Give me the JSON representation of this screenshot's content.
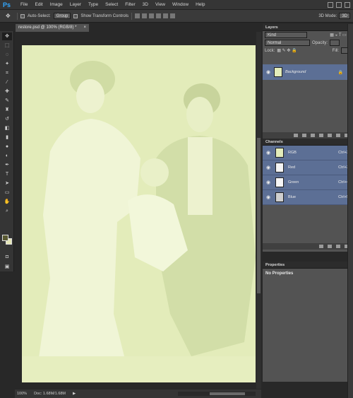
{
  "app": {
    "logo": "Ps"
  },
  "menu": [
    "File",
    "Edit",
    "Image",
    "Layer",
    "Type",
    "Select",
    "Filter",
    "3D",
    "View",
    "Window",
    "Help"
  ],
  "options_bar": {
    "auto_select_label": "Auto-Select:",
    "auto_select_value": "Group",
    "show_transform": "Show Transform Controls",
    "mode3d_label": "3D Mode:",
    "mode3d_value": "3D"
  },
  "doc_tab": {
    "title": "restore.psd @ 100% (RGB/8) *",
    "close": "×"
  },
  "status": {
    "zoom": "100%",
    "doc": "Doc: 1.68M/1.68M"
  },
  "layers_panel": {
    "title": "Layers",
    "filter": "Kind",
    "blend": "Normal",
    "opacity_label": "Opacity:",
    "lock_label": "Lock:",
    "fill_label": "Fill:",
    "layers": [
      {
        "name": "Background",
        "locked": true
      }
    ]
  },
  "channels_panel": {
    "title": "Channels",
    "channels": [
      {
        "name": "RGB",
        "shortcut": "Ctrl+2"
      },
      {
        "name": "Red",
        "shortcut": "Ctrl+3"
      },
      {
        "name": "Green",
        "shortcut": "Ctrl+4"
      },
      {
        "name": "Blue",
        "shortcut": "Ctrl+5"
      }
    ]
  },
  "properties_panel": {
    "title": "Properties",
    "content": "No Properties"
  },
  "colors": {
    "channel_highlight": "#5c6f95",
    "photo_tint": "#e3ecba"
  }
}
